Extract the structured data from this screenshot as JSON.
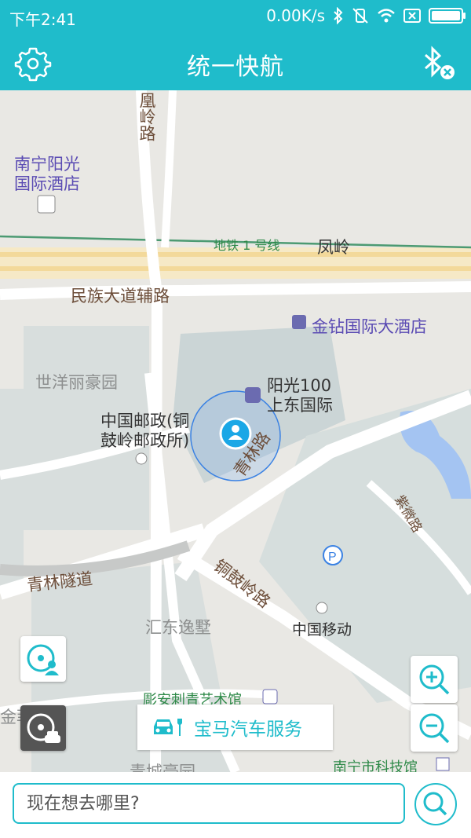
{
  "status_bar": {
    "time": "下午2:41",
    "speed": "0.00K/s"
  },
  "app_bar": {
    "title": "统一快航"
  },
  "map": {
    "labels": {
      "hotel_top": "南宁阳光\n国际酒店",
      "metro": "地铁 1 号线",
      "fengling": "凤岭",
      "fenghuangling_road": "凰岭路",
      "minzu_road": "民族大道辅路",
      "jinzuan_hotel": "金钻国际大酒店",
      "shiyang": "世洋丽豪园",
      "yangguang100": "阳光100\n上东国际",
      "post_office": "中国邮政(铜\n鼓岭邮政所)",
      "qinglin_road": "青林路",
      "qinglin_tunnel": "青林隧道",
      "tonggu_road": "铜鼓岭路",
      "huidong": "汇东逸墅",
      "china_mobile": "中国移动",
      "ziwei_road": "紫微路",
      "diaoan": "彫安刺青艺术馆",
      "jinfei": "金菲园",
      "nanning_museum": "南宁市科技馆",
      "qingcheng": "青城豪园"
    }
  },
  "service": {
    "label": "宝马汽车服务"
  },
  "search": {
    "placeholder": "现在想去哪里?"
  },
  "colors": {
    "accent": "#1fbccb"
  }
}
